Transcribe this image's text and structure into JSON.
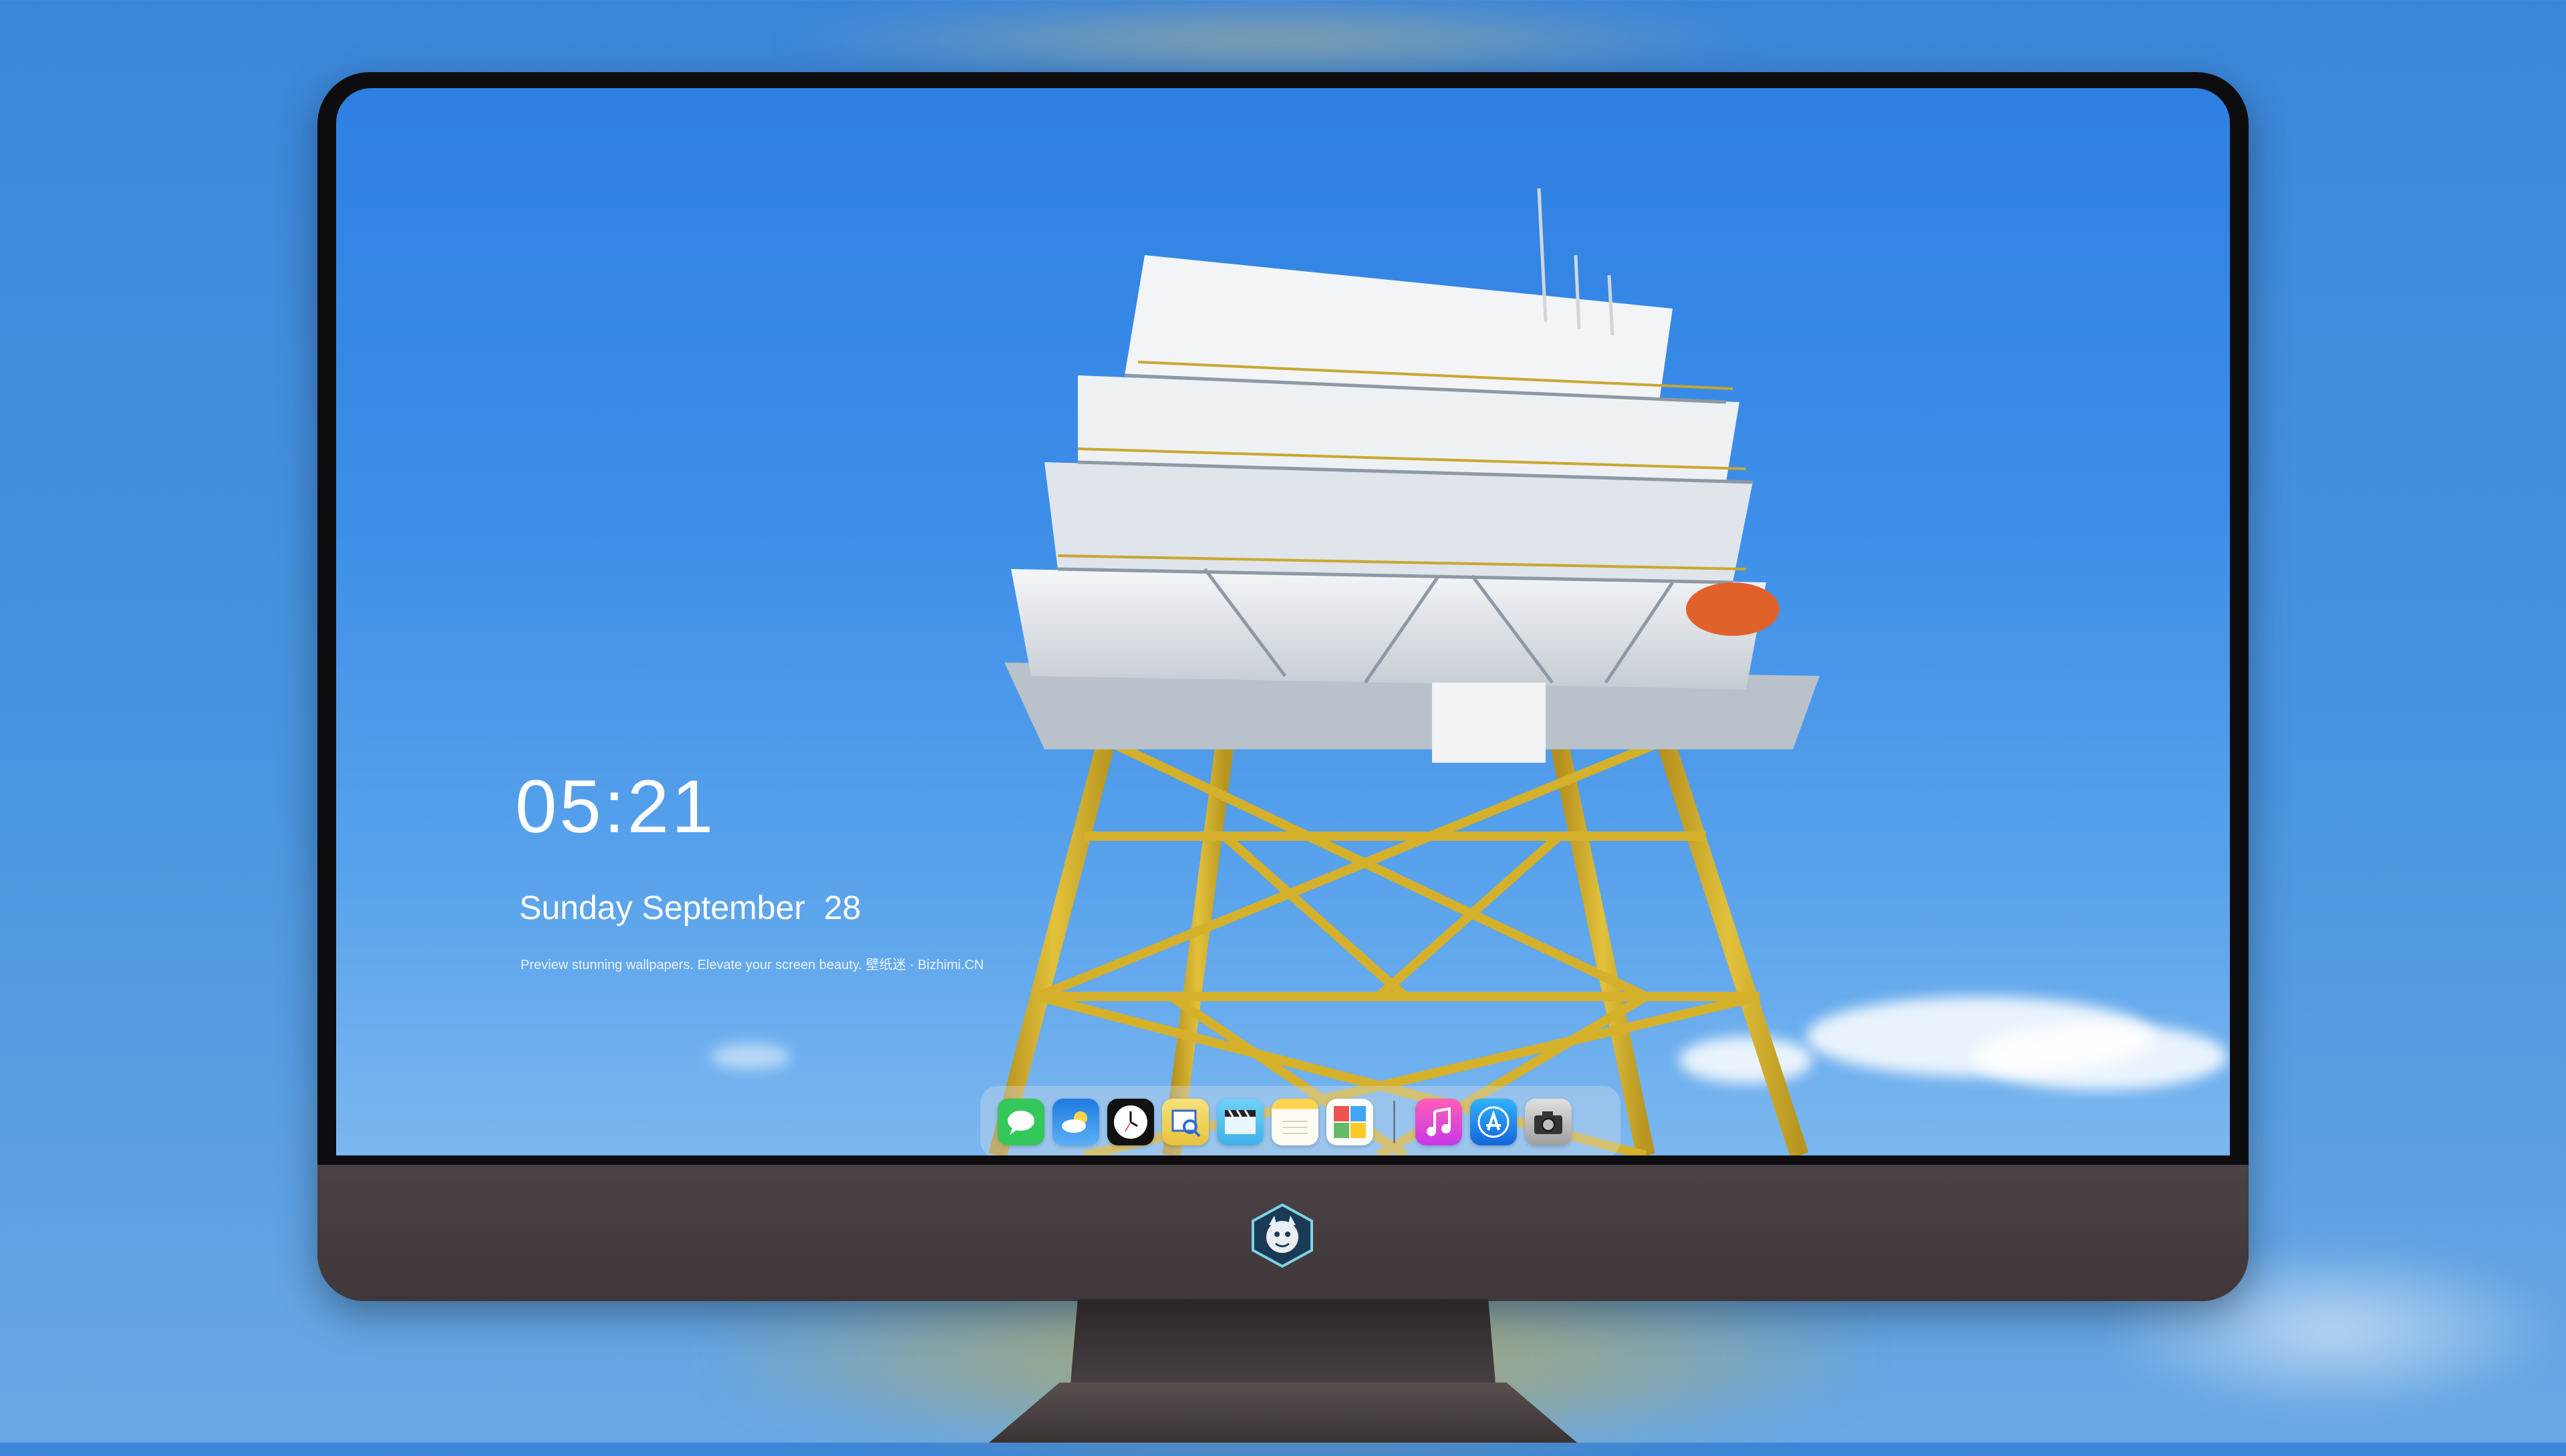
{
  "lock_screen": {
    "time": "05:21",
    "date": "Sunday September  28",
    "tagline": "Preview stunning wallpapers. Elevate your screen beauty. 壁纸迷 · Bizhimi.CN"
  },
  "dock": {
    "apps": [
      {
        "icon": "messages-icon",
        "color": "#34c759"
      },
      {
        "icon": "weather-icon",
        "color": "#2f8cf0"
      },
      {
        "icon": "clock-icon",
        "color": "#ffffff"
      },
      {
        "icon": "preview-icon",
        "color": "#f4d35e"
      },
      {
        "icon": "clips-icon",
        "color": "#4fc3f7"
      },
      {
        "icon": "notes-icon",
        "color": "#ffd54f"
      },
      {
        "icon": "photo-booth-icon",
        "color": "#ef5350"
      },
      {
        "icon": "music-icon",
        "color": "#ff3ba3"
      },
      {
        "icon": "app-store-icon",
        "color": "#1e88e5"
      },
      {
        "icon": "camera-icon",
        "color": "#9e9e9e"
      }
    ]
  },
  "colors": {
    "sky": "#3c8ee8",
    "platform_yellow": "#d9b52a",
    "platform_white": "#e9edf0",
    "lifeboat": "#e0622a",
    "monitor_chin": "#453d3f"
  }
}
